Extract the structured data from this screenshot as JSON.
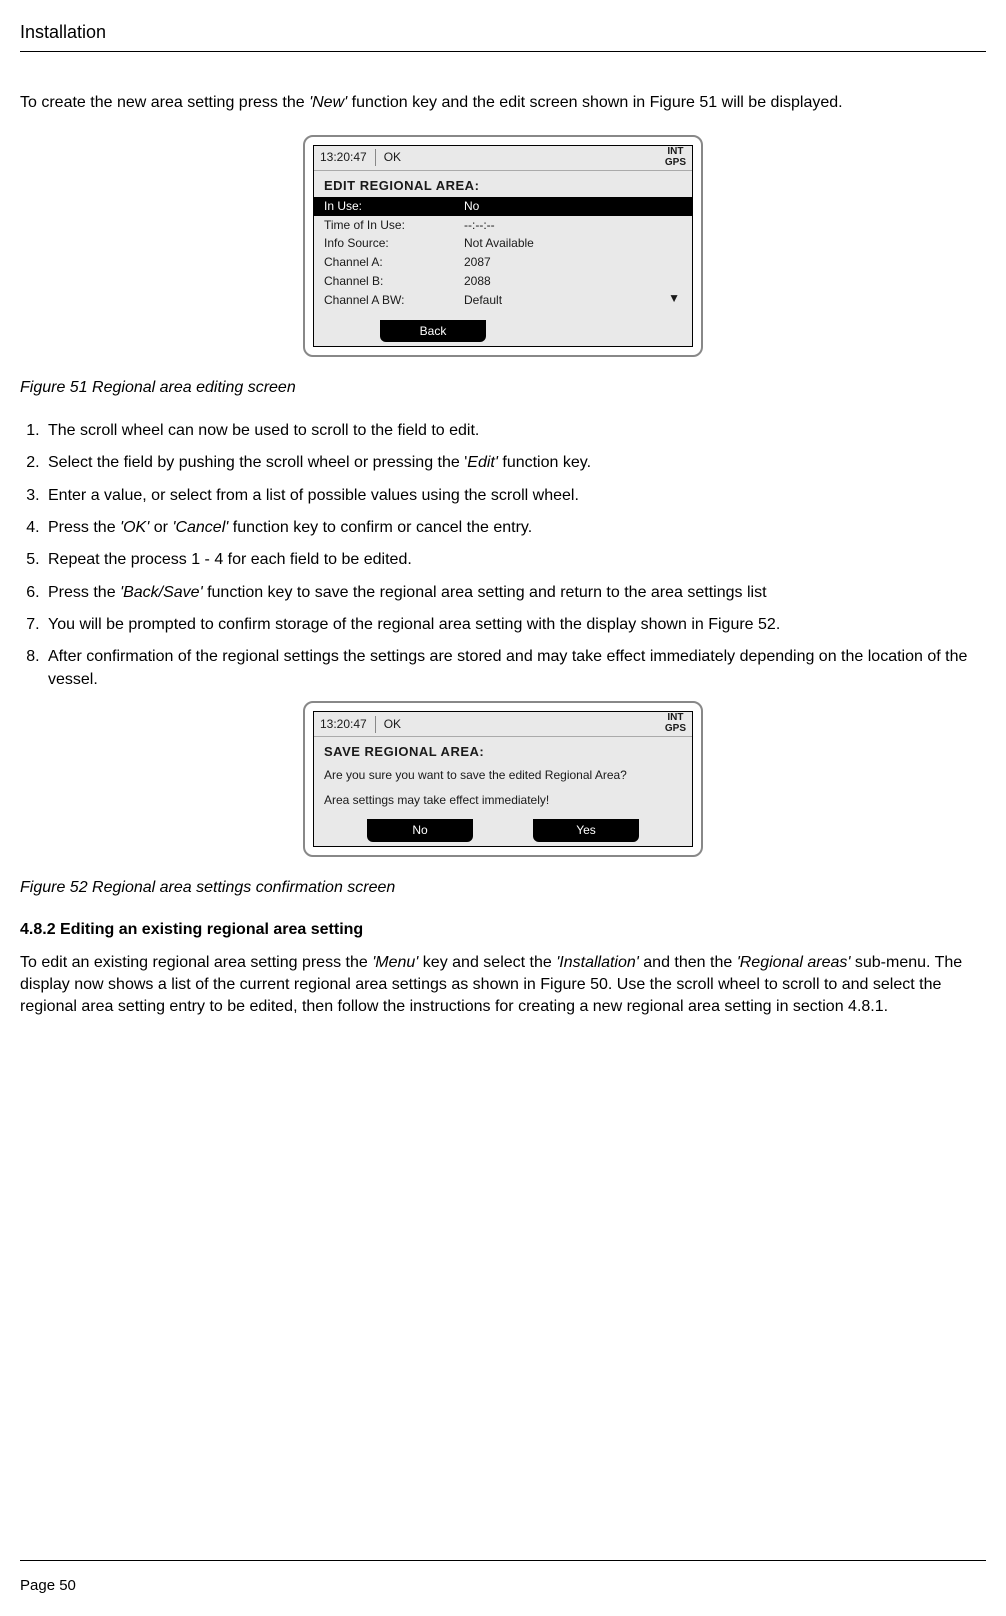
{
  "header": {
    "title": "Installation"
  },
  "intro": {
    "pre": "To create the new area setting press the ",
    "key": "'New'",
    "post": " function key and the edit screen shown in Figure 51 will be displayed."
  },
  "device1": {
    "time": "13:20:47",
    "status": "OK",
    "int": "INT",
    "gps": "GPS",
    "heading": "EDIT REGIONAL AREA:",
    "rows": [
      {
        "label": "In Use:",
        "value": "No",
        "selected": true
      },
      {
        "label": "Time of In Use:",
        "value": "--:--:--",
        "selected": false
      },
      {
        "label": "Info Source:",
        "value": "Not Available",
        "selected": false
      },
      {
        "label": "Channel A:",
        "value": "2087",
        "selected": false
      },
      {
        "label": "Channel B:",
        "value": "2088",
        "selected": false
      },
      {
        "label": "Channel A BW:",
        "value": "Default",
        "selected": false
      }
    ],
    "back_btn": "Back",
    "scroll_arrow": "▼"
  },
  "figure51": {
    "caption": "Figure 51   Regional area editing screen"
  },
  "steps": {
    "s1": "The scroll wheel can now be used to scroll to the field to edit.",
    "s2a": "Select the field by pushing the scroll wheel or pressing the '",
    "s2b": "Edit'",
    "s2c": " function key.",
    "s3": "Enter a value, or select from a list of possible values using the scroll wheel.",
    "s4a": "Press the ",
    "s4b": "'OK'",
    "s4c": " or ",
    "s4d": "'Cancel'",
    "s4e": " function key to confirm or cancel the entry.",
    "s5": "Repeat the process 1 - 4 for each field to be edited.",
    "s6a": "Press the ",
    "s6b": "'Back/Save'",
    "s6c": " function key to save the regional area setting and return to the area settings list",
    "s7": "You will be prompted to confirm storage of the regional area setting with the display shown in Figure 52.",
    "s8": "After confirmation of the regional settings the settings are stored and may take effect immediately depending on the location of the vessel."
  },
  "device2": {
    "time": "13:20:47",
    "status": "OK",
    "int": "INT",
    "gps": "GPS",
    "heading": "SAVE REGIONAL AREA:",
    "line1": "Are you sure you want to save the edited Regional Area?",
    "line2": "Area settings may take effect immediately!",
    "no_btn": "No",
    "yes_btn": "Yes"
  },
  "figure52": {
    "caption": "Figure 52   Regional area settings confirmation screen"
  },
  "section482": {
    "heading": "4.8.2    Editing an existing regional area setting",
    "p1a": "To edit an existing regional area setting press the ",
    "p1b": "'Menu'",
    "p1c": " key and select the ",
    "p1d": "'Installation'",
    "p1e": " and then the ",
    "p1f": "'Regional areas'",
    "p1g": " sub-menu. The display now shows a list of the current regional area settings as shown in Figure 50. Use the scroll wheel to scroll to and select the regional area setting entry to be edited, then follow the instructions for creating a new regional area setting in section 4.8.1."
  },
  "footer": {
    "page": "Page 50"
  }
}
